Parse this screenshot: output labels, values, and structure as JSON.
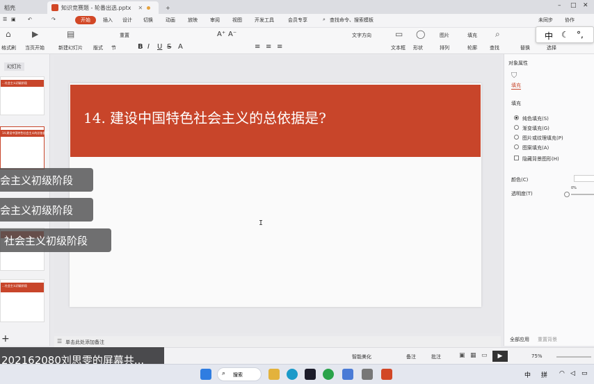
{
  "tabs": [
    {
      "label": "稻壳"
    },
    {
      "label": "知识竞赛题 - 轮番出选.pptx"
    }
  ],
  "menu": [
    "开始",
    "插入",
    "设计",
    "切换",
    "动画",
    "放映",
    "审阅",
    "视图",
    "开发工具",
    "会员专享",
    "查找命令、搜索模板"
  ],
  "menu_right": [
    "未同步",
    "协作"
  ],
  "ribbon": {
    "format_painter": "格式刷",
    "play_from": "当页开始",
    "new_slide": "新建幻灯片",
    "layout": "版式",
    "section": "节",
    "reset": "重置",
    "text_box": "文本框",
    "shape": "形状",
    "arrange": "排列",
    "picture": "图片",
    "fill": "填充",
    "outline": "轮廓",
    "replace": "替换",
    "select": "选择",
    "find_text": "查找",
    "text_color": "文字方向"
  },
  "ime": {
    "label": "中",
    "symbols": "°,"
  },
  "left_panel": {
    "title": "幻灯片",
    "thumb_texts": [
      "...社会主义初级阶段",
      "14.建设中国特色社会主义的总依据是?",
      "...",
      "...社会主义初级阶段"
    ]
  },
  "slide": {
    "title": "14. 建设中国特色社会主义的总依据是?"
  },
  "overlays": [
    "会主义初级阶段",
    "会主义初级阶段",
    "社会主义初级阶段"
  ],
  "right_panel": {
    "header": "对象属性",
    "tab_fill": "填充",
    "section_fill": "填充",
    "options": [
      {
        "label": "纯色填充(S)",
        "selected": true
      },
      {
        "label": "渐变填充(G)",
        "selected": false
      },
      {
        "label": "图片或纹理填充(P)",
        "selected": false
      },
      {
        "label": "图案填充(A)",
        "selected": false
      }
    ],
    "hide_bg": "隐藏背景图形(H)",
    "color_label": "颜色(C)",
    "transparency_label": "透明度(T)",
    "transparency_value": "0%",
    "apply_all": "全部应用",
    "reset_bg": "重置背景"
  },
  "notes_placeholder": "单击此处添加备注",
  "status": {
    "smart": "智能美化",
    "notes": "备注",
    "comment": "批注",
    "zoom": "75%"
  },
  "share_banner": "202162080刘思雯的屏幕共...",
  "taskbar": {
    "search": "搜索",
    "ime1": "中",
    "ime2": "拼"
  },
  "colors": {
    "accent": "#c8452a",
    "ribbon_active": "#d24726"
  }
}
